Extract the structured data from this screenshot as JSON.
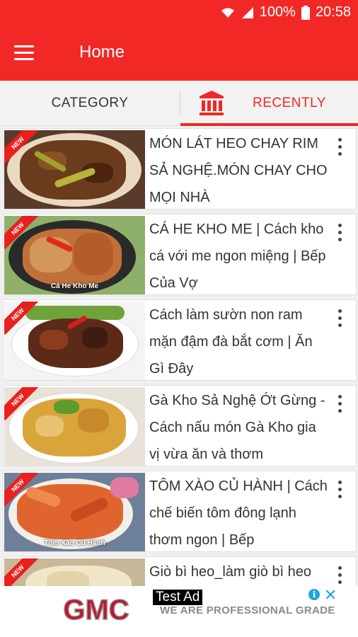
{
  "status_bar": {
    "battery": "100%",
    "time": "20:58",
    "icons": [
      "wifi-icon",
      "signal-icon",
      "battery-icon"
    ]
  },
  "app_bar": {
    "title": "Home",
    "menu_icon": "hamburger-menu-icon"
  },
  "tabs": [
    {
      "label": "CATEGORY",
      "selected": false
    },
    {
      "label": "RECENTLY",
      "selected": true,
      "icon": "bank-building-icon"
    }
  ],
  "list": {
    "items": [
      {
        "title": "MÓN LÁT HEO CHAY RIM SẢ NGHỆ.MÓN CHAY CHO MỌI NHÀ",
        "badge": "NEW",
        "thumb_caption": ""
      },
      {
        "title": "CÁ HE KHO ME | Cách kho cá với me ngon miệng | Bếp Của Vợ",
        "badge": "NEW",
        "thumb_caption": "Cá He Kho Me"
      },
      {
        "title": "Cách làm sườn non ram mặn đậm đà bắt cơm | Ăn Gì Đây",
        "badge": "NEW",
        "thumb_caption": ""
      },
      {
        "title": "Gà Kho Sả Nghệ Ớt Gừng - Cách nấu món Gà Kho gia vị vừa ăn và thơm",
        "badge": "NEW",
        "thumb_caption": ""
      },
      {
        "title": "TÔM XÀO CỦ HÀNH | Cách chế biến tôm đông lạnh thơm ngon | Bếp",
        "badge": "NEW",
        "thumb_caption": "Tôm Xào Củ Hành"
      },
      {
        "title": "Giò bì heo_làm giò bì heo",
        "badge": "NEW",
        "thumb_caption": ""
      }
    ],
    "more_icon": "more-vert-icon"
  },
  "ad": {
    "label": "Test Ad",
    "brand": "GMC",
    "tagline": "WE ARE PROFESSIONAL GRADE",
    "info_glyph": "i",
    "close_glyph": "✕"
  },
  "colors": {
    "primary": "#f22826",
    "accent": "#1ea4e0"
  }
}
